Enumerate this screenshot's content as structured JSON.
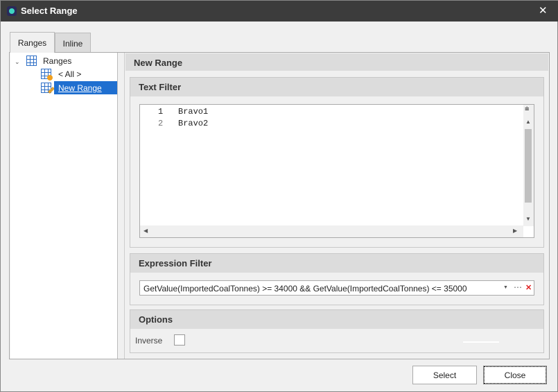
{
  "window": {
    "title": "Select Range",
    "close_icon": "close-icon"
  },
  "tabs": [
    {
      "label": "Ranges",
      "active": true
    },
    {
      "label": "Inline",
      "active": false
    }
  ],
  "tree": {
    "root": "Ranges",
    "children": [
      {
        "label": "< All >"
      },
      {
        "label": "New Range",
        "selected": true
      }
    ]
  },
  "main": {
    "header": "New Range",
    "text_filter": {
      "title": "Text Filter",
      "lines": [
        {
          "num": "1",
          "text": "Bravo1"
        },
        {
          "num": "2",
          "text": "Bravo2"
        }
      ]
    },
    "expression_filter": {
      "title": "Expression Filter",
      "value": "GetValue(ImportedCoalTonnes) >= 34000 && GetValue(ImportedCoalTonnes) <= 35000"
    },
    "options": {
      "title": "Options",
      "inverse_label": "Inverse",
      "inverse_checked": false
    }
  },
  "buttons": {
    "select": "Select",
    "close": "Close"
  },
  "colors": {
    "selection": "#1f6fd0",
    "titlebar": "#3c3c3c",
    "clear": "#e02020"
  }
}
